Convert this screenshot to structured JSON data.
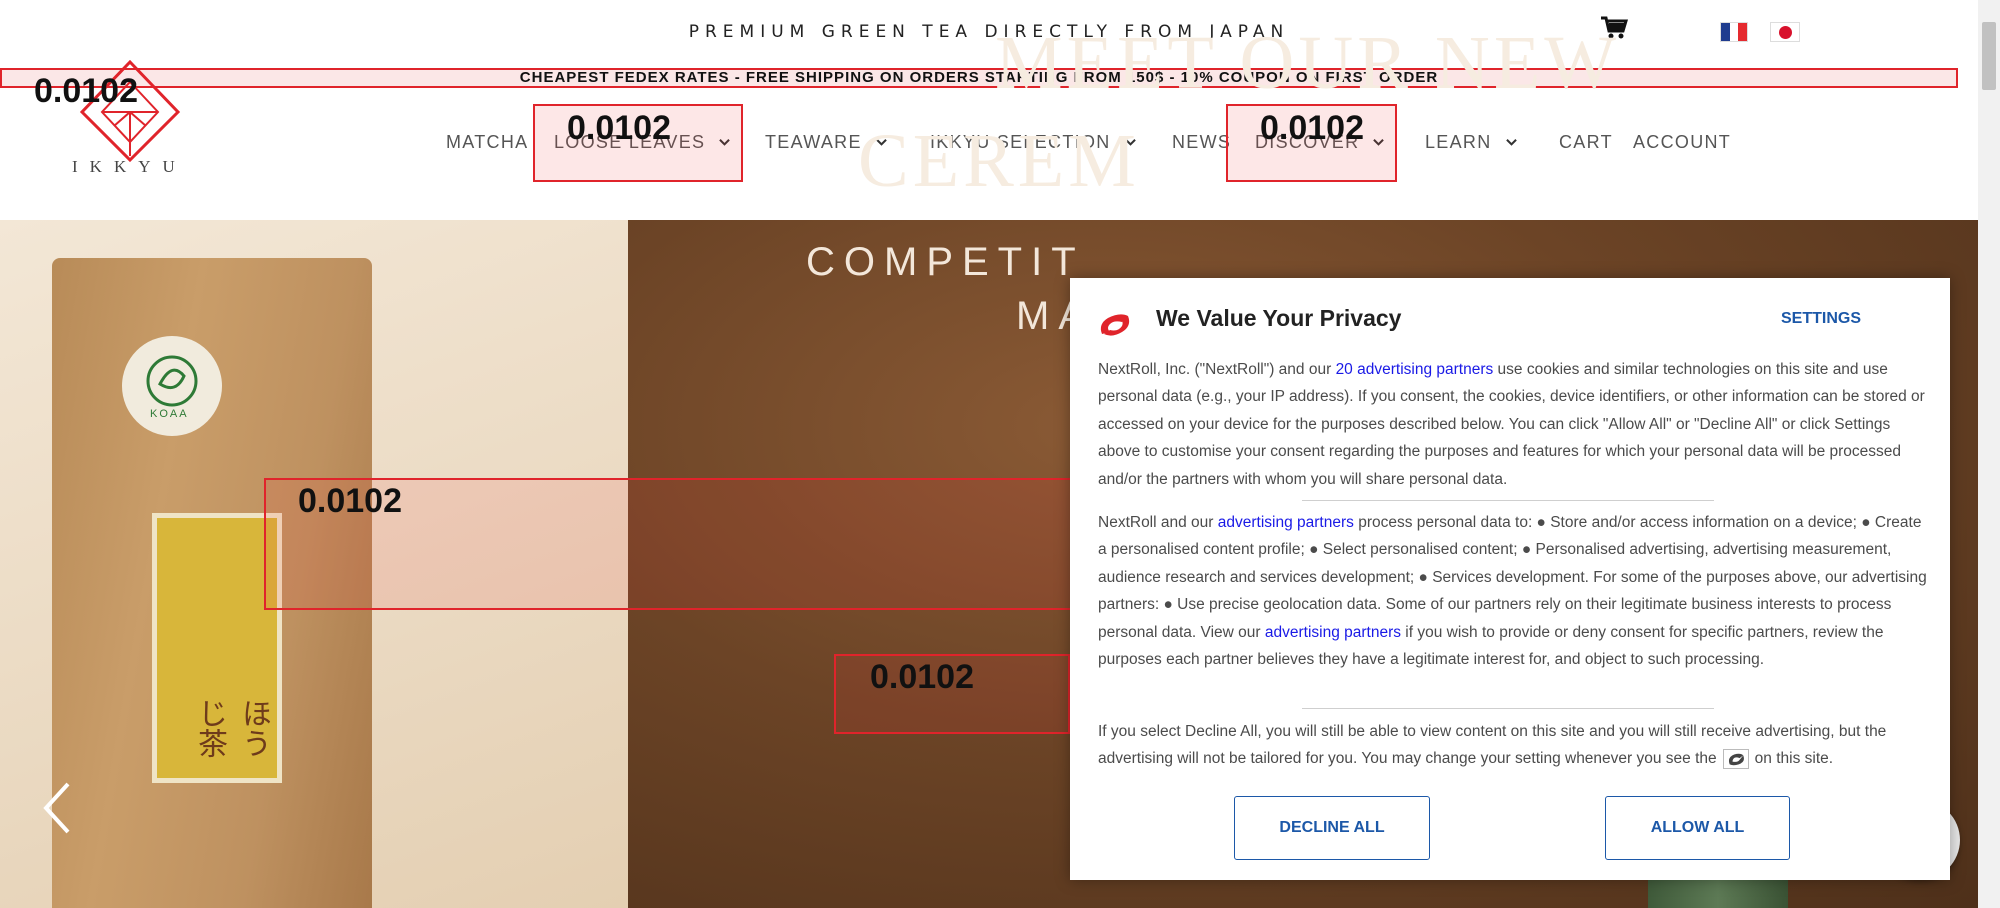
{
  "topbar": {
    "tagline": "PREMIUM GREEN TEA DIRECTLY FROM JAPAN",
    "cart_icon": "cart-icon",
    "flags": [
      {
        "icon": "france-flag-icon",
        "colors": [
          "#1f3c8f",
          "#ffffff",
          "#e52a2f"
        ]
      },
      {
        "icon": "japan-flag-icon",
        "colors": [
          "#ffffff",
          "#d8112c"
        ]
      }
    ]
  },
  "banner": {
    "text": "CHEAPEST FEDEX RATES - FREE SHIPPING ON ORDERS STARTING FROM 150$ - 10% COUPON ON FIRST ORDER"
  },
  "logo": {
    "text": "IKKYU",
    "color": "#e0242b"
  },
  "nav": {
    "items": [
      {
        "label": "MATCHA",
        "dropdown": false
      },
      {
        "label": "LOOSE LEAVES",
        "dropdown": true
      },
      {
        "label": "TEAWARE",
        "dropdown": true
      },
      {
        "label": "IKKYU SELECTION",
        "dropdown": true
      },
      {
        "label": "NEWS",
        "dropdown": false
      },
      {
        "label": "DISCOVER",
        "dropdown": true
      },
      {
        "label": "LEARN",
        "dropdown": true
      },
      {
        "label": "CART",
        "dropdown": false
      },
      {
        "label": "ACCOUNT",
        "dropdown": false
      }
    ]
  },
  "overlays": {
    "label": "0.0102",
    "color": "#e0242b"
  },
  "hero": {
    "title_line1": "MEET OUR NEW",
    "title_line2": "CEREM",
    "subtitle_line1": "COMPETIT",
    "subtitle_line2": "MA",
    "bag_label": "ほうじ茶",
    "seal_text": "KOAA",
    "prev_icon": "chevron-left-icon"
  },
  "privacy": {
    "title": "We Value Your Privacy",
    "settings_label": "SETTINGS",
    "logo_icon": "nextroll-logo-icon",
    "p1_before": "NextRoll, Inc. (\"NextRoll\") and our ",
    "p1_link": "20 advertising partners",
    "p1_after": " use cookies and similar technologies on this site and use personal data (e.g., your IP address). If you consent, the cookies, device identifiers, or other information can be stored or accessed on your device for the purposes described below. You can click \"Allow All\" or \"Decline All\" or click Settings above to customise your consent regarding the purposes and features for which your personal data will be processed and/or the partners with whom you will share personal data.",
    "p2_before": "NextRoll and our ",
    "p2_link1": "advertising partners",
    "p2_middle": " process personal data to: ● Store and/or access information on a device; ● Create a personalised content profile; ● Select personalised content; ● Personalised advertising, advertising measurement, audience research and services development; ● Services development. For some of the purposes above, our advertising partners: ● Use precise geolocation data. Some of our partners rely on their legitimate business interests to process personal data. View our ",
    "p2_link2": "advertising partners",
    "p2_after": " if you wish to provide or deny consent for specific partners, review the purposes each partner believes they have a legitimate interest for, and object to such processing.",
    "p3_before": "If you select Decline All, you will still be able to view content on this site and you will still receive advertising, but the advertising will not be tailored for you. You may change your setting whenever you see the",
    "p3_after": "on this site.",
    "decline_label": "DECLINE ALL",
    "allow_label": "ALLOW ALL",
    "accent_color": "#1c58a8"
  }
}
